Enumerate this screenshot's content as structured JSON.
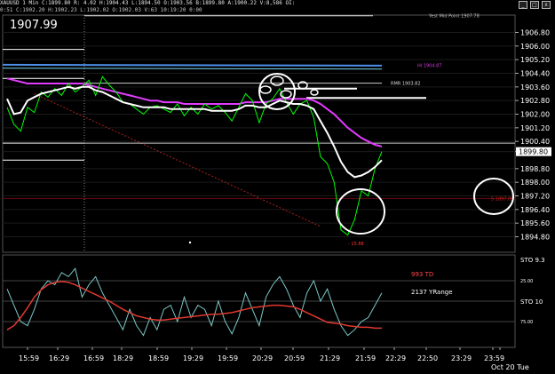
{
  "header": {
    "line1": "XAUUSD 1 Min  C:1899.80  R:   4.02  H:1904.43  L:1894.50  O:1903.56  B:1899.80  A:1900.22  V:8,586  OI:",
    "line2": "0:51  C:1902.20  H:1902.23  L:1902.02  O:1902.03  V:63  10:19:20  0:00"
  },
  "window_buttons": [
    "_",
    "□",
    "x"
  ],
  "current_price_label": "1907.99",
  "colors": {
    "price": "#00ff00",
    "ma_white": "#ffffff",
    "ma_magenta": "#e23bff",
    "blue_line": "#4d8fe8",
    "cyan_line": "#76d6f0",
    "red_line": "#d11111",
    "osc_red": "#e0392f",
    "osc_cyan": "#7cc8c8",
    "grid": "#7a7a7a"
  },
  "chart_data": [
    {
      "type": "line",
      "x_ticks": [
        "15:59",
        "16:29",
        "16:59",
        "18:29",
        "18:59",
        "19:29",
        "19:59",
        "20:29",
        "20:59",
        "21:29",
        "21:59",
        "22:29",
        "22:50",
        "23:29",
        "23:59",
        "Oct 20 Tue"
      ],
      "y_ticks": [
        "1906.80",
        "1906.00",
        "1905.20",
        "1904.40",
        "1903.60",
        "1902.80",
        "1902.00",
        "1901.20",
        "1900.40",
        "1899.80",
        "1898.80",
        "1898.00",
        "1897.20",
        "1896.40",
        "1895.60",
        "1894.80"
      ],
      "ylim": [
        1894.2,
        1907.4
      ],
      "last_price": "1899.80",
      "series": [
        {
          "values": [
            1902.4,
            1901.4,
            1901.0,
            1902.4,
            1902.1,
            1903.3,
            1903.0,
            1903.5,
            1903.1,
            1903.8,
            1903.3,
            1903.6,
            1904.0,
            1903.1,
            1904.2,
            1903.7,
            1903.3,
            1902.7,
            1902.6,
            1902.3,
            1902.0,
            1902.4,
            1902.5,
            1902.3,
            1902.1,
            1902.6,
            1901.9,
            1902.4,
            1902.0,
            1902.6,
            1902.3,
            1902.5,
            1902.1,
            1901.6,
            1902.4,
            1903.2,
            1902.8,
            1901.5,
            1902.6,
            1902.9,
            1903.5,
            1902.7,
            1902.0,
            1902.6,
            1902.8,
            1901.8,
            1899.5,
            1899.1,
            1898.0,
            1895.2,
            1894.9,
            1895.8,
            1897.5,
            1897.2,
            1898.8,
            1899.8
          ]
        },
        {
          "values": [
            1902.9,
            1902.0,
            1902.1,
            1902.8,
            1903.0,
            1903.2,
            1903.3,
            1903.4,
            1903.5,
            1903.6,
            1903.5,
            1903.6,
            1903.6,
            1903.4,
            1903.3,
            1903.1,
            1902.9,
            1902.7,
            1902.6,
            1902.5,
            1902.4,
            1902.4,
            1902.4,
            1902.4,
            1902.3,
            1902.3,
            1902.3,
            1902.3,
            1902.3,
            1902.3,
            1902.2,
            1902.2,
            1902.2,
            1902.2,
            1902.3,
            1902.5,
            1902.5,
            1902.4,
            1902.4,
            1902.6,
            1902.8,
            1902.7,
            1902.6,
            1902.6,
            1902.5,
            1902.3,
            1901.6,
            1900.9,
            1900.1,
            1899.2,
            1898.6,
            1898.3,
            1898.4,
            1898.6,
            1898.9,
            1899.3
          ]
        },
        {
          "values": [
            1904.1,
            1904.0,
            1903.9,
            1903.8,
            1903.8,
            1903.8,
            1903.8,
            1903.8,
            1903.8,
            1903.8,
            1903.8,
            1903.8,
            1903.7,
            1903.6,
            1903.5,
            1903.4,
            1903.3,
            1903.2,
            1903.1,
            1903.0,
            1902.9,
            1902.8,
            1902.8,
            1902.7,
            1902.7,
            1902.7,
            1902.6,
            1902.6,
            1902.6,
            1902.6,
            1902.6,
            1902.6,
            1902.6,
            1902.6,
            1902.6,
            1902.7,
            1902.7,
            1902.7,
            1902.7,
            1902.8,
            1902.9,
            1902.9,
            1902.9,
            1902.9,
            1902.9,
            1902.8,
            1902.6,
            1902.3,
            1902.0,
            1901.6,
            1901.2,
            1900.9,
            1900.6,
            1900.4,
            1900.2,
            1900.1
          ]
        }
      ],
      "levels": [
        {
          "label": "Yest Mid Point 1907.78",
          "value": 1907.78
        },
        {
          "label": "HI 1904.87",
          "value": 1904.87
        },
        {
          "label": "RMR 1903.82",
          "value": 1903.82
        },
        {
          "label": "",
          "value": 1902.9
        },
        {
          "label": "",
          "value": 1900.3
        },
        {
          "label": "S 1897.05",
          "value": 1897.05
        }
      ],
      "annotations": [
        "- 15.88"
      ]
    },
    {
      "type": "line",
      "x_ticks": [
        "15:59",
        "16:29",
        "16:59",
        "18:29",
        "18:59",
        "19:29",
        "19:59",
        "20:29",
        "20:59",
        "21:29",
        "21:59",
        "22:29",
        "22:50",
        "23:29",
        "23:59",
        "Oct 20 Tue"
      ],
      "y_ticks": [
        "STO 9.3",
        "25.00",
        "STO 10",
        "75.00"
      ],
      "ylim": [
        0,
        100
      ],
      "labels": [
        "993 TD",
        "2137 YRange"
      ],
      "series": [
        {
          "values": [
            85,
            80,
            70,
            58,
            45,
            36,
            30,
            27,
            26,
            27,
            30,
            34,
            38,
            42,
            46,
            50,
            55,
            60,
            64,
            68,
            70,
            72,
            73,
            73,
            72,
            71,
            70,
            69,
            68,
            67,
            66,
            66,
            65,
            64,
            62,
            60,
            58,
            57,
            56,
            55,
            55,
            56,
            57,
            60,
            64,
            68,
            72,
            76,
            77,
            78,
            80,
            81,
            82,
            82,
            83,
            83
          ]
        },
        {
          "values": [
            35,
            55,
            75,
            80,
            60,
            35,
            25,
            30,
            15,
            20,
            10,
            45,
            30,
            20,
            40,
            55,
            70,
            85,
            60,
            80,
            92,
            70,
            85,
            60,
            55,
            75,
            45,
            70,
            55,
            60,
            80,
            50,
            75,
            90,
            70,
            40,
            60,
            80,
            45,
            30,
            20,
            35,
            55,
            70,
            40,
            25,
            50,
            35,
            60,
            80,
            92,
            85,
            75,
            70,
            55,
            40
          ]
        }
      ]
    }
  ]
}
